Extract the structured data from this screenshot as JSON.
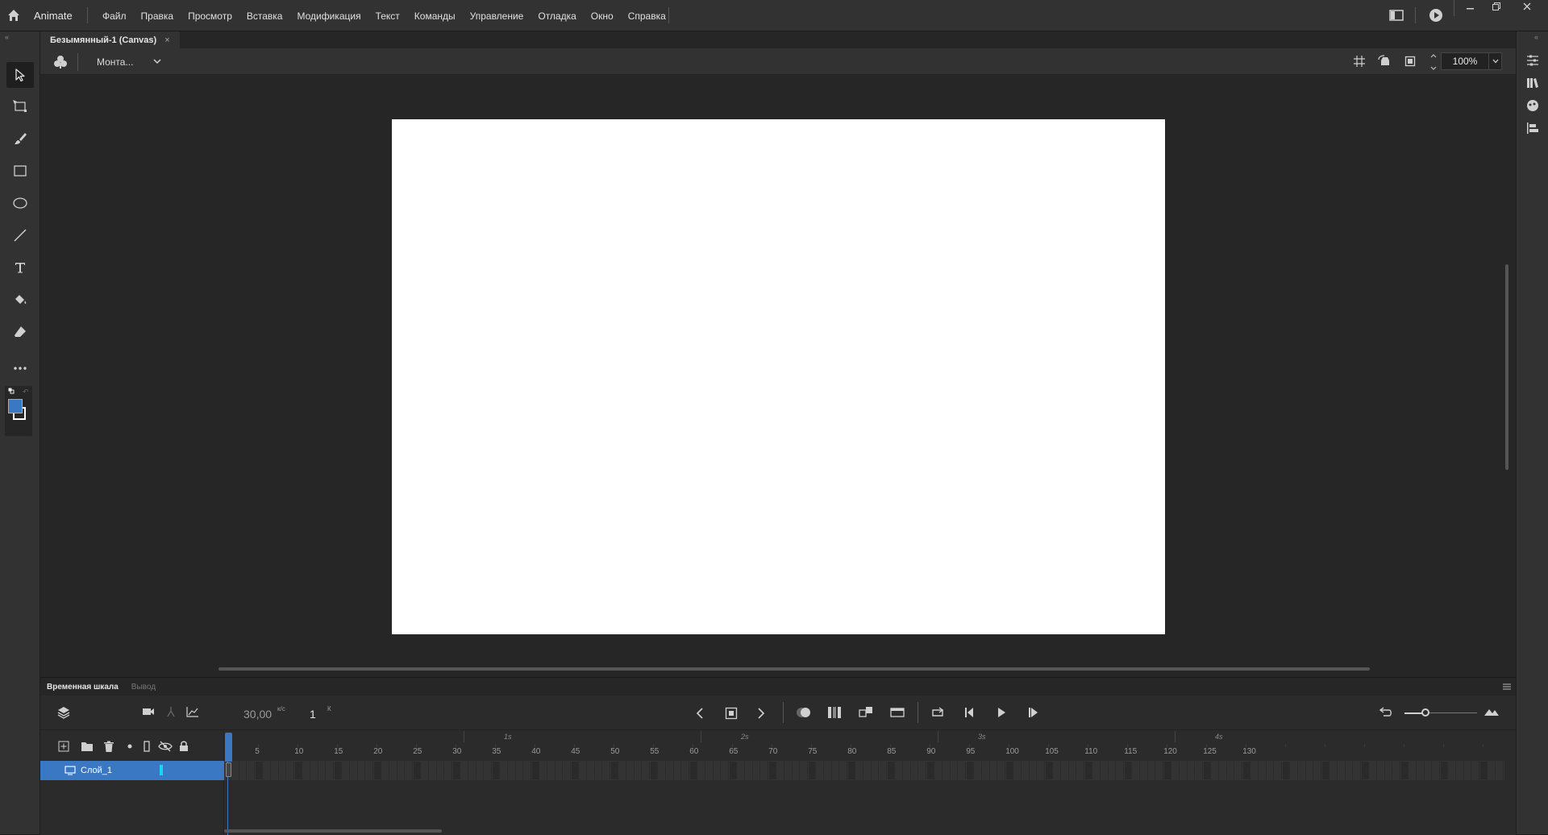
{
  "app": {
    "name": "Animate",
    "menu": [
      "Файл",
      "Правка",
      "Просмотр",
      "Вставка",
      "Модификация",
      "Текст",
      "Команды",
      "Управление",
      "Отладка",
      "Окно",
      "Справка"
    ]
  },
  "document": {
    "tab_title": "Безымянный-1 (Canvas)",
    "close_glyph": "×"
  },
  "scene_bar": {
    "scene_label": "Монта...",
    "zoom_value": "100%"
  },
  "timeline": {
    "tabs": [
      "Временная шкала",
      "Вывод"
    ],
    "fps": "30,00",
    "fps_unit": "к/с",
    "current_frame": "1",
    "frame_unit": "К",
    "layer_name": "Слой_1",
    "ruler_numbers": [
      "5",
      "10",
      "15",
      "20",
      "25",
      "30",
      "35",
      "40",
      "45",
      "50",
      "55",
      "60",
      "65",
      "70",
      "75",
      "80",
      "85",
      "90",
      "95",
      "100",
      "105",
      "110",
      "115",
      "120",
      "125",
      "130"
    ],
    "ruler_seconds": [
      "1s",
      "2s",
      "3s",
      "4s"
    ]
  },
  "colors": {
    "accent": "#3a78c3",
    "fill_swatch": "#3a78c3",
    "stroke_swatch": "#ffffff",
    "stage": "#ffffff",
    "layer_marker": "#16d6f0"
  },
  "icons": {
    "home": "home-icon",
    "selection": "selection-arrow-icon",
    "free_transform": "free-transform-icon",
    "brush": "brush-icon",
    "rectangle": "rectangle-icon",
    "oval": "oval-icon",
    "line": "line-icon",
    "text": "text-tool-icon",
    "paint_bucket": "paint-bucket-icon",
    "eraser": "eraser-icon",
    "more": "more-tools-icon"
  }
}
